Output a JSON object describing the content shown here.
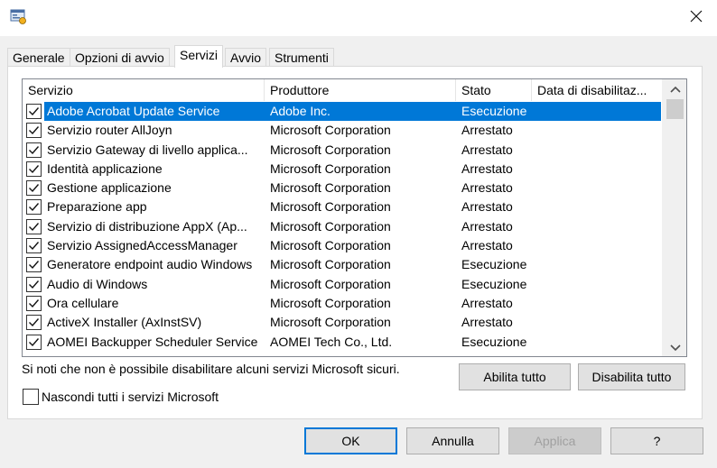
{
  "window": {
    "close_glyph": "✕"
  },
  "tabs": [
    {
      "label": "Generale"
    },
    {
      "label": "Opzioni di avvio"
    },
    {
      "label": "Servizi"
    },
    {
      "label": "Avvio"
    },
    {
      "label": "Strumenti"
    }
  ],
  "active_tab": "Servizi",
  "columns": [
    {
      "label": "Servizio"
    },
    {
      "label": "Produttore"
    },
    {
      "label": "Stato"
    },
    {
      "label": "Data di disabilitaz..."
    }
  ],
  "services": [
    {
      "name": "Adobe Acrobat Update Service",
      "vendor": "Adobe Inc.",
      "status": "Esecuzione",
      "disabled_date": "",
      "checked": true,
      "selected": true
    },
    {
      "name": "Servizio router AllJoyn",
      "vendor": "Microsoft Corporation",
      "status": "Arrestato",
      "disabled_date": "",
      "checked": true
    },
    {
      "name": "Servizio Gateway di livello applica...",
      "vendor": "Microsoft Corporation",
      "status": "Arrestato",
      "disabled_date": "",
      "checked": true
    },
    {
      "name": "Identità applicazione",
      "vendor": "Microsoft Corporation",
      "status": "Arrestato",
      "disabled_date": "",
      "checked": true
    },
    {
      "name": "Gestione applicazione",
      "vendor": "Microsoft Corporation",
      "status": "Arrestato",
      "disabled_date": "",
      "checked": true
    },
    {
      "name": "Preparazione app",
      "vendor": "Microsoft Corporation",
      "status": "Arrestato",
      "disabled_date": "",
      "checked": true
    },
    {
      "name": "Servizio di distribuzione AppX (Ap...",
      "vendor": "Microsoft Corporation",
      "status": "Arrestato",
      "disabled_date": "",
      "checked": true
    },
    {
      "name": "Servizio AssignedAccessManager",
      "vendor": "Microsoft Corporation",
      "status": "Arrestato",
      "disabled_date": "",
      "checked": true
    },
    {
      "name": "Generatore endpoint audio Windows",
      "vendor": "Microsoft Corporation",
      "status": "Esecuzione",
      "disabled_date": "",
      "checked": true
    },
    {
      "name": "Audio di Windows",
      "vendor": "Microsoft Corporation",
      "status": "Esecuzione",
      "disabled_date": "",
      "checked": true
    },
    {
      "name": "Ora cellulare",
      "vendor": "Microsoft Corporation",
      "status": "Arrestato",
      "disabled_date": "",
      "checked": true
    },
    {
      "name": "ActiveX Installer (AxInstSV)",
      "vendor": "Microsoft Corporation",
      "status": "Arrestato",
      "disabled_date": "",
      "checked": true
    },
    {
      "name": "AOMEI Backupper Scheduler Service",
      "vendor": "AOMEI Tech Co., Ltd.",
      "status": "Esecuzione",
      "disabled_date": "",
      "checked": true
    }
  ],
  "note": "Si noti che non è possibile disabilitare alcuni servizi Microsoft sicuri.",
  "buttons": {
    "enable_all": "Abilita tutto",
    "disable_all": "Disabilita tutto",
    "ok": "OK",
    "cancel": "Annulla",
    "apply": "Applica",
    "help": "?"
  },
  "hide_ms": {
    "label": "Nascondi tutti i servizi Microsoft",
    "checked": false
  },
  "colors": {
    "selection": "#0078d7",
    "default_button_border": "#0078d7"
  }
}
